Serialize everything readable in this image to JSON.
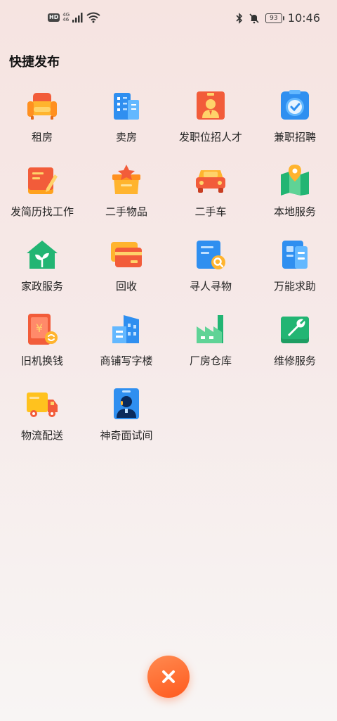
{
  "status_bar": {
    "hd": "HD",
    "network_top": "4G",
    "network_bottom": "46",
    "battery": "93",
    "time": "10:46"
  },
  "title": "快捷发布",
  "items": [
    {
      "label": "租房",
      "icon": "sofa-icon"
    },
    {
      "label": "卖房",
      "icon": "building-icon"
    },
    {
      "label": "发职位招人才",
      "icon": "id-card-person-icon"
    },
    {
      "label": "兼职招聘",
      "icon": "clock-icon"
    },
    {
      "label": "发简历找工作",
      "icon": "resume-pen-icon"
    },
    {
      "label": "二手物品",
      "icon": "box-star-icon"
    },
    {
      "label": "二手车",
      "icon": "car-icon"
    },
    {
      "label": "本地服务",
      "icon": "map-pin-icon"
    },
    {
      "label": "家政服务",
      "icon": "house-leaf-icon"
    },
    {
      "label": "回收",
      "icon": "cards-icon"
    },
    {
      "label": "寻人寻物",
      "icon": "document-search-icon"
    },
    {
      "label": "万能求助",
      "icon": "document-icon"
    },
    {
      "label": "旧机换钱",
      "icon": "phone-yuan-icon"
    },
    {
      "label": "商铺写字楼",
      "icon": "office-building-icon"
    },
    {
      "label": "厂房仓库",
      "icon": "factory-icon"
    },
    {
      "label": "维修服务",
      "icon": "wrench-icon"
    },
    {
      "label": "物流配送",
      "icon": "truck-icon"
    },
    {
      "label": "神奇面试间",
      "icon": "interview-person-icon"
    }
  ],
  "close_icon": "close-icon",
  "colors": {
    "accent": "#ff6a2c",
    "orange": "#ff8a1e",
    "blue": "#2f8ff0",
    "green": "#22b573",
    "red": "#f25c3a"
  }
}
